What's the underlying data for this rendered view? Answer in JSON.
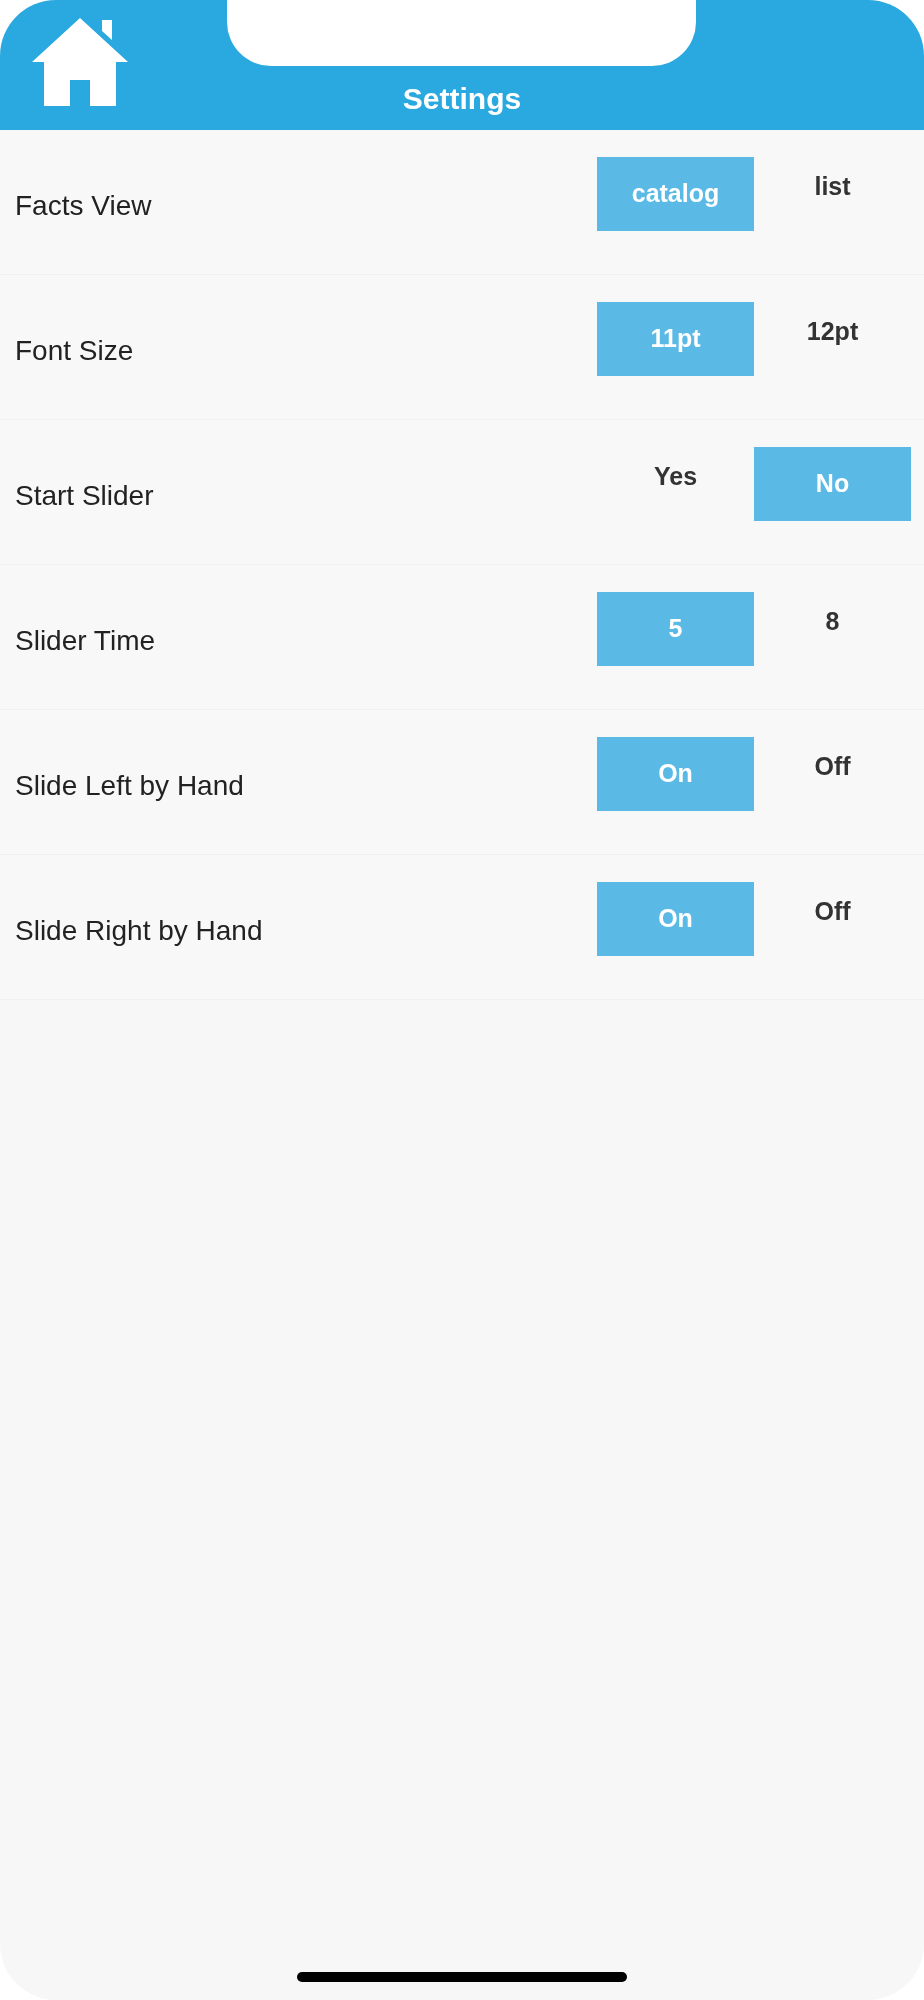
{
  "header": {
    "title": "Settings"
  },
  "settings": [
    {
      "label": "Facts View",
      "options": [
        {
          "label": "catalog",
          "selected": true
        },
        {
          "label": "list",
          "selected": false
        }
      ]
    },
    {
      "label": "Font Size",
      "options": [
        {
          "label": "11pt",
          "selected": true
        },
        {
          "label": "12pt",
          "selected": false
        }
      ]
    },
    {
      "label": "Start Slider",
      "options": [
        {
          "label": "Yes",
          "selected": false
        },
        {
          "label": "No",
          "selected": true
        }
      ]
    },
    {
      "label": "Slider Time",
      "options": [
        {
          "label": "5",
          "selected": true
        },
        {
          "label": "8",
          "selected": false
        }
      ]
    },
    {
      "label": "Slide Left by Hand",
      "options": [
        {
          "label": "On",
          "selected": true
        },
        {
          "label": "Off",
          "selected": false
        }
      ]
    },
    {
      "label": "Slide Right by Hand",
      "options": [
        {
          "label": "On",
          "selected": true
        },
        {
          "label": "Off",
          "selected": false
        }
      ]
    }
  ]
}
